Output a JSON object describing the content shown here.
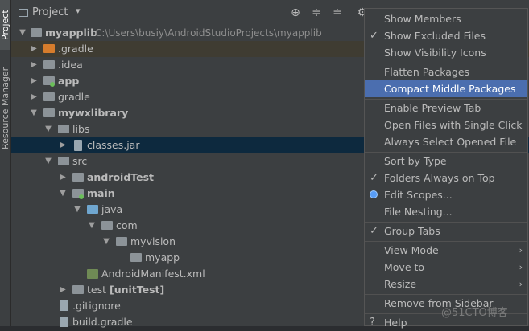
{
  "sidebar": {
    "project_tab": "Project",
    "resource_tab": "Resource Manager"
  },
  "panel": {
    "title": "Project"
  },
  "tree": [
    {
      "label": "myapplib",
      "path": "C:\\Users\\busiy\\AndroidStudioProjects\\myapplib",
      "bold": true
    },
    {
      "label": ".gradle"
    },
    {
      "label": ".idea"
    },
    {
      "label": "app",
      "bold": true
    },
    {
      "label": "gradle"
    },
    {
      "label": "mywxlibrary",
      "bold": true
    },
    {
      "label": "libs"
    },
    {
      "label": "classes.jar"
    },
    {
      "label": "src"
    },
    {
      "label": "androidTest",
      "bold": true
    },
    {
      "label": "main",
      "bold": true
    },
    {
      "label": "java"
    },
    {
      "label": "com"
    },
    {
      "label": "myvision"
    },
    {
      "label": "myapp"
    },
    {
      "label": "AndroidManifest.xml"
    },
    {
      "label": "test",
      "suffix": "[unitTest]"
    },
    {
      "label": ".gitignore"
    },
    {
      "label": "build.gradle"
    }
  ],
  "menu": {
    "items": [
      {
        "label": "Show Members",
        "checked": false
      },
      {
        "label": "Show Excluded Files",
        "checked": true
      },
      {
        "label": "Show Visibility Icons",
        "checked": false
      },
      {
        "label": "Flatten Packages",
        "checked": false
      },
      {
        "label": "Compact Middle Packages",
        "checked": false,
        "active": true
      },
      {
        "label": "Enable Preview Tab",
        "checked": false
      },
      {
        "label": "Open Files with Single Click",
        "checked": false
      },
      {
        "label": "Always Select Opened File",
        "checked": false
      },
      {
        "label": "Sort by Type",
        "checked": false
      },
      {
        "label": "Folders Always on Top",
        "checked": true
      },
      {
        "label": "Edit Scopes...",
        "radio": true
      },
      {
        "label": "File Nesting...",
        "checked": false
      },
      {
        "label": "Group Tabs",
        "checked": true
      },
      {
        "label": "View Mode",
        "submenu": true
      },
      {
        "label": "Move to",
        "submenu": true
      },
      {
        "label": "Resize",
        "submenu": true
      },
      {
        "label": "Remove from Sidebar"
      },
      {
        "label": "Help",
        "help": true
      }
    ]
  },
  "watermark": "@51CTO博客"
}
